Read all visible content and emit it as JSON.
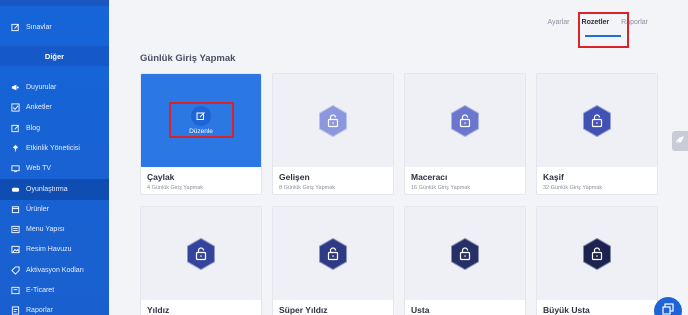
{
  "sidebar": {
    "top_item": {
      "label": "Sınavlar",
      "icon": "edit-icon"
    },
    "section_label": "Diğer",
    "items": [
      {
        "label": "Duyurular",
        "icon": "megaphone-icon"
      },
      {
        "label": "Anketler",
        "icon": "checkbox-icon"
      },
      {
        "label": "Blog",
        "icon": "edit-icon"
      },
      {
        "label": "Etkinlik Yöneticisi",
        "icon": "pin-icon"
      },
      {
        "label": "Web TV",
        "icon": "tv-icon"
      },
      {
        "label": "Oyunlaştırma",
        "icon": "gamepad-icon",
        "active": true
      },
      {
        "label": "Ürünler",
        "icon": "box-icon"
      },
      {
        "label": "Menu Yapısı",
        "icon": "menu-icon"
      },
      {
        "label": "Resim Havuzu",
        "icon": "image-icon"
      },
      {
        "label": "Aktivasyon Kodları",
        "icon": "tag-icon"
      },
      {
        "label": "E-Ticaret",
        "icon": "cart-icon"
      },
      {
        "label": "Raporlar",
        "icon": "report-icon"
      }
    ]
  },
  "tabs": [
    {
      "label": "Ayarlar",
      "active": false
    },
    {
      "label": "Rozetler",
      "active": true
    },
    {
      "label": "Raporlar",
      "active": false
    }
  ],
  "section_title": "Günlük Giriş Yapmak",
  "edit_label": "Düzenle",
  "badges": [
    {
      "name": "Çaylak",
      "desc": "4 Günlük Giriş Yapmak",
      "color": "#2b78e4",
      "selected": true
    },
    {
      "name": "Gelişen",
      "desc": "8 Günlük Giriş Yapmak",
      "color": "#8c97dd"
    },
    {
      "name": "Maceracı",
      "desc": "16 Günlük Giriş Yapmak",
      "color": "#6b77cf"
    },
    {
      "name": "Kaşif",
      "desc": "32 Günlük Giriş Yapmak",
      "color": "#4251b4"
    },
    {
      "name": "Yıldız",
      "desc": "",
      "color": "#34449c"
    },
    {
      "name": "Süper Yıldız",
      "desc": "",
      "color": "#2e3b84"
    },
    {
      "name": "Usta",
      "desc": "",
      "color": "#263066"
    },
    {
      "name": "Büyük Usta",
      "desc": "",
      "color": "#1c2350"
    }
  ],
  "colors": {
    "sidebar": "#1565d8",
    "accent": "#1f6fe0",
    "highlight": "#d8232a"
  }
}
